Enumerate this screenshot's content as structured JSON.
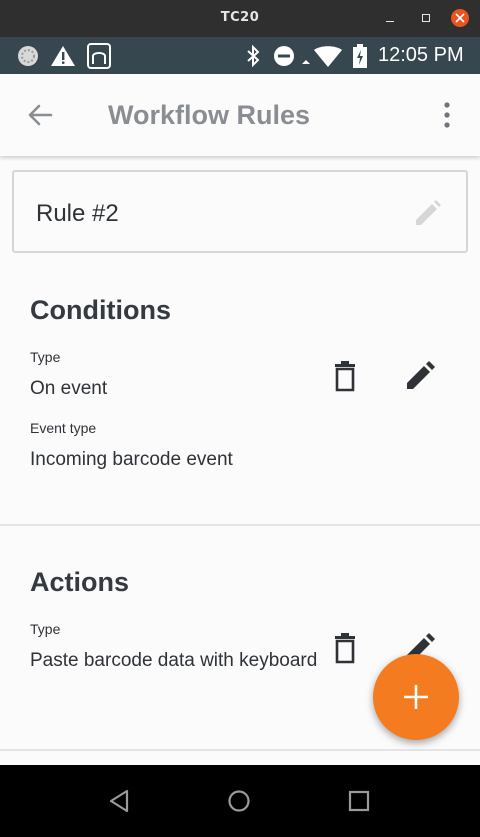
{
  "window": {
    "title": "TC20"
  },
  "status_bar": {
    "time": "12:05 PM",
    "icons": [
      "sync-icon",
      "warning-icon",
      "sim-icon",
      "bluetooth-icon",
      "do-not-disturb-icon",
      "wifi-icon",
      "battery-charging-icon"
    ]
  },
  "app_bar": {
    "title": "Workflow Rules"
  },
  "rule": {
    "name": "Rule #2"
  },
  "conditions": {
    "title": "Conditions",
    "type_label": "Type",
    "type_value": "On event",
    "event_type_label": "Event type",
    "event_type_value": "Incoming barcode event"
  },
  "actions": {
    "title": "Actions",
    "type_label": "Type",
    "type_value": "Paste barcode data with keyboard"
  },
  "colors": {
    "accent": "#f47b20",
    "status_bar": "#37474f",
    "text": "#2f3237",
    "title_muted": "#8a8e92"
  }
}
